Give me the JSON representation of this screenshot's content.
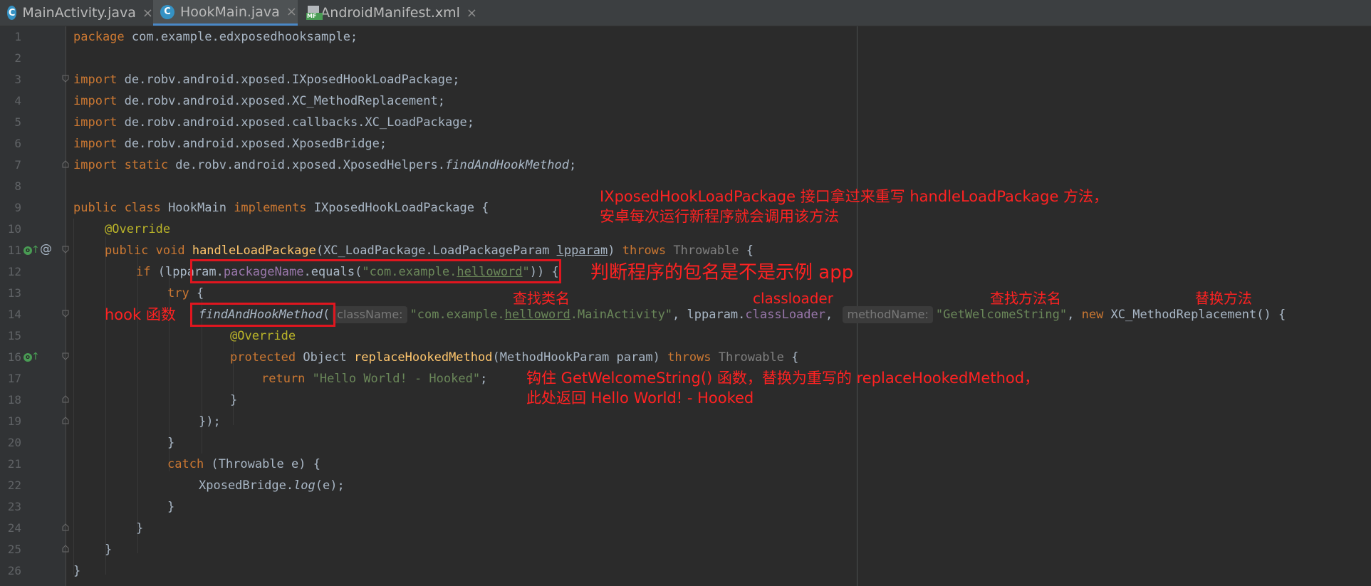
{
  "tabs": [
    {
      "label": "MainActivity.java",
      "icon": "java-class-icon"
    },
    {
      "label": "HookMain.java",
      "icon": "java-class-icon",
      "active": true
    },
    {
      "label": "AndroidManifest.xml",
      "icon": "manifest-icon"
    }
  ],
  "tab_icons": {
    "class_letter": "C",
    "manifest_letters": "MF",
    "close": "×"
  },
  "line_numbers": [
    "1",
    "2",
    "3",
    "4",
    "5",
    "6",
    "7",
    "8",
    "9",
    "10",
    "11",
    "12",
    "13",
    "14",
    "15",
    "16",
    "17",
    "18",
    "19",
    "20",
    "21",
    "22",
    "23",
    "24",
    "25",
    "26"
  ],
  "code": {
    "l1": {
      "kw": "package",
      "rest": " com.example.edxposedhooksample;"
    },
    "l3": {
      "kw": "import",
      "rest": " de.robv.android.xposed.IXposedHookLoadPackage;"
    },
    "l4": {
      "kw": "import",
      "rest": " de.robv.android.xposed.XC_MethodReplacement;"
    },
    "l5": {
      "kw": "import",
      "rest": " de.robv.android.xposed.callbacks.XC_LoadPackage;"
    },
    "l6": {
      "kw": "import",
      "rest": " de.robv.android.xposed.XposedBridge;"
    },
    "l7": {
      "kw": "import static",
      "rest": " de.robv.android.xposed.XposedHelpers.",
      "it": "findAndHookMethod",
      "end": ";"
    },
    "l9": {
      "kw1": "public class",
      "name": " HookMain ",
      "kw2": "implements",
      "rest": " IXposedHookLoadPackage {"
    },
    "l10": {
      "ann": "@Override"
    },
    "l11": {
      "kw": "public void ",
      "fn": "handleLoadPackage",
      "p1": "(XC_LoadPackage.LoadPackageParam ",
      "p2": "lpparam",
      "p3": ") ",
      "kw2": "throws",
      "p4": " ",
      "gray": "Throwable",
      "p5": " {"
    },
    "l12": {
      "kw": "if",
      "p1": " (",
      "p2": "lpparam.",
      "fld": "packageName",
      "p3": ".equals(",
      "s1": "\"com.example.",
      "s2": "helloword",
      "s3": "\"",
      "p4": ")) {"
    },
    "l13": {
      "kw": "try",
      "rest": " {"
    },
    "l14": {
      "it": "findAndHookMethod",
      "p1": "(",
      "hint1": "className:",
      "s1": "\"com.example.",
      "s2": "helloword",
      "s3": ".MainActivity\"",
      "p2": ", lpparam.",
      "fld": "classLoader",
      "p3": ", ",
      "hint2": "methodName:",
      "s4": "\"GetWelcomeString\"",
      "p4": ", ",
      "kw": "new",
      "p5": " XC_MethodReplacement() {"
    },
    "l15": {
      "ann": "@Override"
    },
    "l16": {
      "kw": "protected",
      "p1": " Object ",
      "fn": "replaceHookedMethod",
      "p2": "(MethodHookParam param) ",
      "kw2": "throws",
      "p3": " ",
      "gray": "Throwable",
      "p4": " {"
    },
    "l17": {
      "kw": "return",
      "p1": " ",
      "str": "\"Hello World! - Hooked\"",
      "p2": ";"
    },
    "l18": {
      "rest": "}"
    },
    "l19": {
      "rest": "});"
    },
    "l20": {
      "rest": "}"
    },
    "l21": {
      "kw": "catch",
      "rest": " (Throwable e) {"
    },
    "l22": {
      "p1": "XposedBridge.",
      "it": "log",
      "p2": "(e);"
    },
    "l23": {
      "rest": "}"
    },
    "l24": {
      "rest": "}"
    },
    "l25": {
      "rest": "}"
    },
    "l26": {
      "rest": "}"
    }
  },
  "gutter_marks": {
    "override_o": "o",
    "up_arrow": "↑",
    "at_sign": "@"
  },
  "annotations": {
    "note1_line1": "IXposedHookLoadPackage 接口拿过来重写 handleLoadPackage 方法，",
    "note1_line2": "安卓每次运行新程序就会调用该方法",
    "note_package": "判断程序的包名是不是示例 app",
    "note_find_class": "查找类名",
    "note_classloader": "classloader",
    "note_find_method": "查找方法名",
    "note_replace": "替换方法",
    "note_hook_fn": "hook 函数",
    "note_hooked_line1": "钩住 GetWelcomeString() 函数，替换为重写的 replaceHookedMethod，",
    "note_hooked_line2": "此处返回 Hello World! - Hooked"
  },
  "colors": {
    "background": "#2b2b2b",
    "keyword": "#cc7832",
    "string": "#6a8759",
    "annotation_red": "#ff2222",
    "method": "#ffc66d",
    "field": "#9876aa"
  }
}
